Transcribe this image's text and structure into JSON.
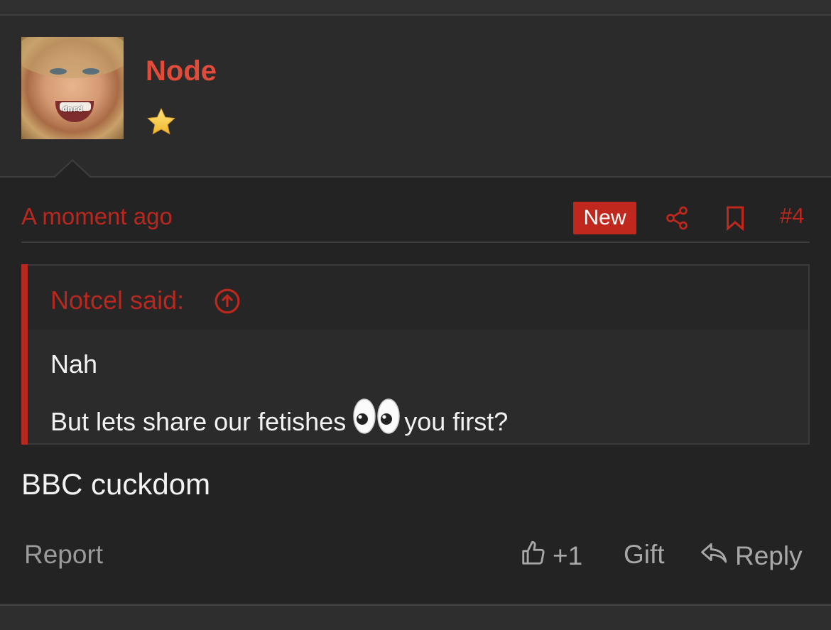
{
  "post": {
    "author": {
      "username": "Node",
      "avatar_caption": "dnrd",
      "badge_icon": "star-icon"
    },
    "timestamp": "A moment ago",
    "new_label": "New",
    "post_number": "#4",
    "quote": {
      "author_label": "Notcel said:",
      "line1": "Nah",
      "line2_before": "But lets share our fetishes",
      "line2_emoji": "eyes-emoji",
      "line2_after": "you first?"
    },
    "body": "BBC cuckdom",
    "actions": {
      "report_label": "Report",
      "like_count": "+1",
      "gift_label": "Gift",
      "reply_label": "Reply"
    }
  },
  "colors": {
    "accent": "#e04b3a",
    "accent_dark": "#b8281f",
    "background": "#232323",
    "text": "#f2f2f2",
    "muted": "#a8a8a8"
  }
}
